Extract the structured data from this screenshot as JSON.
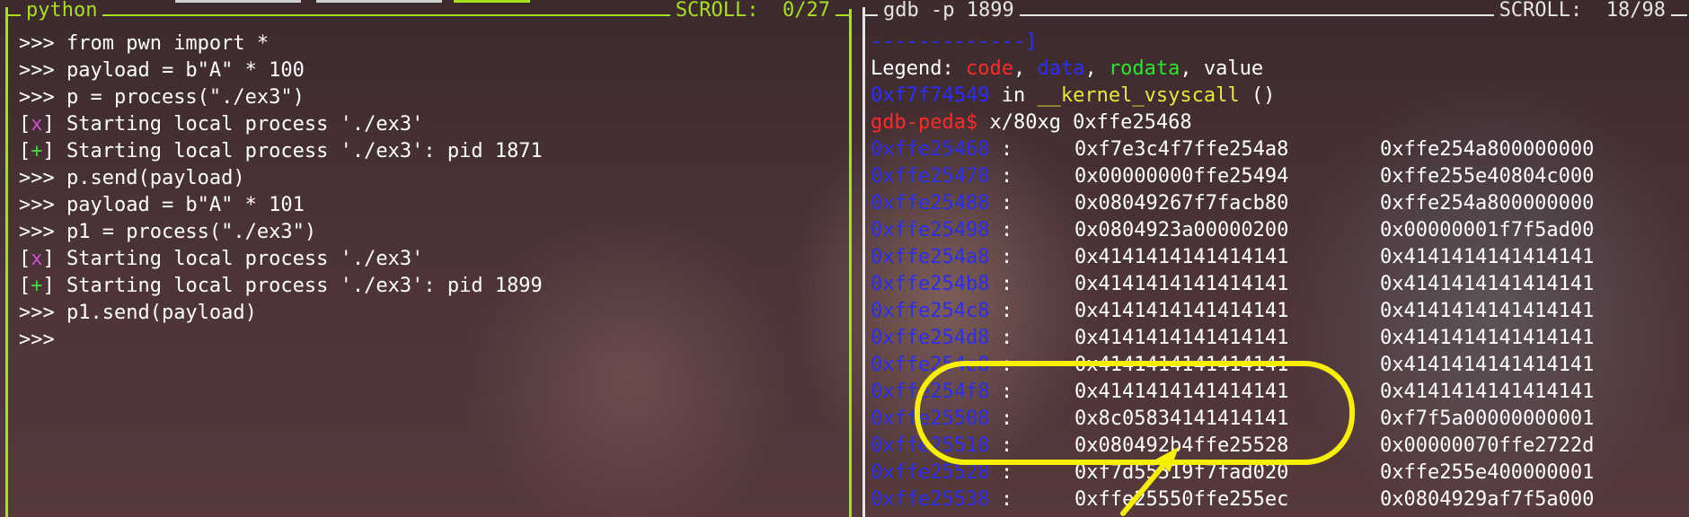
{
  "left_pane": {
    "title": "python",
    "scroll": "SCROLL:  0/27",
    "lines": [
      {
        "prompt": ">>> ",
        "text": "from pwn import *"
      },
      {
        "prompt": ">>> ",
        "text": "payload = b\"A\" * 100"
      },
      {
        "prompt": ">>> ",
        "text": "p = process(\"./ex3\")"
      },
      {
        "status": "x",
        "text": " Starting local process './ex3'"
      },
      {
        "status": "+",
        "text": " Starting local process './ex3': pid 1871"
      },
      {
        "prompt": ">>> ",
        "text": "p.send(payload)"
      },
      {
        "prompt": ">>> ",
        "text": "payload = b\"A\" * 101"
      },
      {
        "prompt": ">>> ",
        "text": "p1 = process(\"./ex3\")"
      },
      {
        "status": "x",
        "text": " Starting local process './ex3'"
      },
      {
        "status": "+",
        "text": " Starting local process './ex3': pid 1899"
      },
      {
        "prompt": ">>> ",
        "text": "p1.send(payload)"
      },
      {
        "prompt": ">>>",
        "text": ""
      }
    ]
  },
  "right_pane": {
    "title": "gdb -p 1899",
    "scroll": "SCROLL:  18/98",
    "separator": "-------------]",
    "legend": {
      "label": "Legend: ",
      "code": "code",
      "data": "data",
      "rodata": "rodata",
      "value": "value",
      "sep": ", "
    },
    "frame": {
      "addr": "0xf7f74549",
      "in": " in ",
      "func": "__kernel_vsyscall",
      "args": " ()"
    },
    "gdb_prompt": "gdb-peda$",
    "command": " x/80xg 0xffe25468",
    "memory": [
      {
        "addr": "0xffe25468",
        "v1": "0xf7e3c4f7ffe254a8",
        "v2": "0xffe254a800000000"
      },
      {
        "addr": "0xffe25478",
        "v1": "0x00000000ffe25494",
        "v2": "0xffe255e40804c000"
      },
      {
        "addr": "0xffe25488",
        "v1": "0x08049267f7facb80",
        "v2": "0xffe254a800000000"
      },
      {
        "addr": "0xffe25498",
        "v1": "0x0804923a00000200",
        "v2": "0x00000001f7f5ad00"
      },
      {
        "addr": "0xffe254a8",
        "v1": "0x4141414141414141",
        "v2": "0x4141414141414141"
      },
      {
        "addr": "0xffe254b8",
        "v1": "0x4141414141414141",
        "v2": "0x4141414141414141"
      },
      {
        "addr": "0xffe254c8",
        "v1": "0x4141414141414141",
        "v2": "0x4141414141414141"
      },
      {
        "addr": "0xffe254d8",
        "v1": "0x4141414141414141",
        "v2": "0x4141414141414141"
      },
      {
        "addr": "0xffe254e8",
        "v1": "0x4141414141414141",
        "v2": "0x4141414141414141"
      },
      {
        "addr": "0xffe254f8",
        "v1": "0x4141414141414141",
        "v2": "0x4141414141414141"
      },
      {
        "addr": "0xffe25508",
        "v1": "0x8c05834141414141",
        "v2": "0xf7f5a00000000001"
      },
      {
        "addr": "0xffe25518",
        "v1": "0x080492b4ffe25528",
        "v2": "0x00000070ffe2722d"
      },
      {
        "addr": "0xffe25528",
        "v1": "0xf7d55519f7fad020",
        "v2": "0xffe255e400000001"
      },
      {
        "addr": "0xffe25538",
        "v1": "0xffe25550ffe255ec",
        "v2": "0x0804929af7f5a000"
      }
    ]
  },
  "colors": {
    "accent": "#a8e01f",
    "annotation": "#f6f000"
  }
}
